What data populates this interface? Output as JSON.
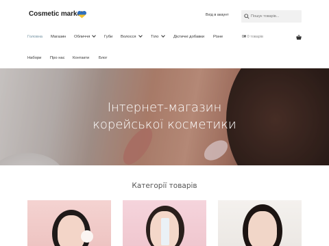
{
  "header": {
    "logo_text": "Cosmetic market",
    "login_label": "Вхід в акаунт",
    "search_placeholder": "Пошук товарів..."
  },
  "nav_primary": [
    {
      "label": "Головна",
      "active": true,
      "dropdown": false
    },
    {
      "label": "Магазин",
      "active": false,
      "dropdown": false
    },
    {
      "label": "Обличчя",
      "active": false,
      "dropdown": true
    },
    {
      "label": "Губи",
      "active": false,
      "dropdown": false
    },
    {
      "label": "Волосся",
      "active": false,
      "dropdown": true
    },
    {
      "label": "Тіло",
      "active": false,
      "dropdown": true
    },
    {
      "label": "Дієтичні добавки",
      "active": false,
      "dropdown": false
    },
    {
      "label": "Різне",
      "active": false,
      "dropdown": false
    }
  ],
  "cart": {
    "amount": "0₴",
    "count_label": "0 товарів"
  },
  "nav_secondary": [
    {
      "label": "Набори"
    },
    {
      "label": "Про нас"
    },
    {
      "label": "Контакти"
    },
    {
      "label": "Блог"
    }
  ],
  "hero": {
    "title_line1": "Інтернет-магазин",
    "title_line2": "корейської косметики"
  },
  "categories": {
    "title": "Категорії товарів"
  },
  "colors": {
    "active_nav": "#6f8e9e",
    "flag_blue": "#2f6fbe",
    "flag_yellow": "#f2c230"
  },
  "icons": [
    "heart-flag-icon",
    "search-icon",
    "chevron-down-icon",
    "basket-icon"
  ]
}
